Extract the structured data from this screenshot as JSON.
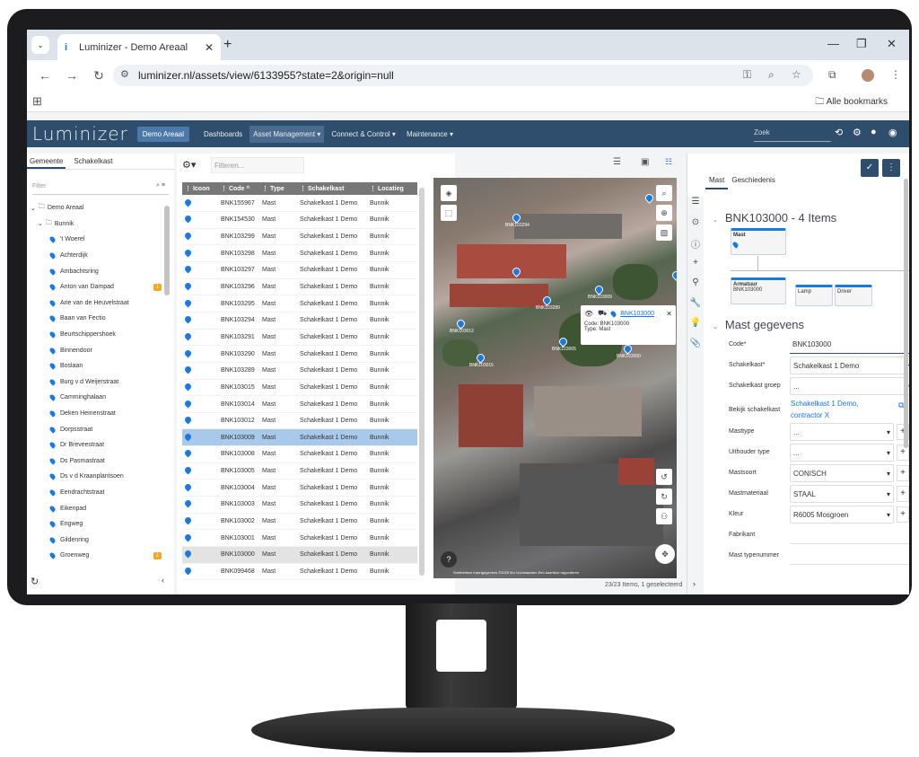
{
  "browser": {
    "tab_title": "Luminizer - Demo Areaal",
    "tab_icon": "i",
    "url": "luminizer.nl/assets/view/6133955?state=2&origin=null",
    "all_bookmarks": "Alle bookmarks"
  },
  "app": {
    "logo": "Luminizer",
    "areaal_button": "Demo Areaal",
    "menu": [
      "Dashboards",
      "Asset Management ▾",
      "Connect & Control ▾",
      "Maintenance ▾"
    ],
    "search_placeholder": "Zoek"
  },
  "left": {
    "tabs": [
      "Gemeente",
      "Schakelkast"
    ],
    "filter_placeholder": "Filter",
    "tree_root": "Demo Areaal",
    "tree_city": "Bunnik",
    "streets": [
      "'t Woerel",
      "Achterdijk",
      "Ambachtsring",
      "Anton van Dampad",
      "Arie van de Heuvelstraat",
      "Baan van Fectio",
      "Beurtschippershoek",
      "Binnendoor",
      "Boslaan",
      "Burg v d Weijerstraat",
      "Camminghalaan",
      "Deken Heinenstraat",
      "Dorpsstraat",
      "Dr Breveestraat",
      "Ds Pasmastraat",
      "Ds v d Kraanplantsoen",
      "Eendrachtstraat",
      "Eikenpad",
      "Engweg",
      "Gildenring",
      "Groenweg"
    ],
    "badges": {
      "Anton van Dampad": "1",
      "Groenweg": "1"
    }
  },
  "table": {
    "filter_placeholder": "Filteren...",
    "headers": [
      "Icoon",
      "Code ^",
      "Type",
      "Schakelkast",
      "Locatieg"
    ],
    "rows": [
      [
        "BNK155967",
        "Mast",
        "Schakelkast 1 Demo",
        "Bunnik"
      ],
      [
        "BNK154530",
        "Mast",
        "Schakelkast 1 Demo",
        "Bunnik"
      ],
      [
        "BNK103299",
        "Mast",
        "Schakelkast 1 Demo",
        "Bunnik"
      ],
      [
        "BNK103298",
        "Mast",
        "Schakelkast 1 Demo",
        "Bunnik"
      ],
      [
        "BNK103297",
        "Mast",
        "Schakelkast 1 Demo",
        "Bunnik"
      ],
      [
        "BNK103296",
        "Mast",
        "Schakelkast 1 Demo",
        "Bunnik"
      ],
      [
        "BNK103295",
        "Mast",
        "Schakelkast 1 Demo",
        "Bunnik"
      ],
      [
        "BNK103294",
        "Mast",
        "Schakelkast 1 Demo",
        "Bunnik"
      ],
      [
        "BNK103291",
        "Mast",
        "Schakelkast 1 Demo",
        "Bunnik"
      ],
      [
        "BNK103290",
        "Mast",
        "Schakelkast 1 Demo",
        "Bunnik"
      ],
      [
        "BNK103289",
        "Mast",
        "Schakelkast 1 Demo",
        "Bunnik"
      ],
      [
        "BNK103015",
        "Mast",
        "Schakelkast 1 Demo",
        "Bunnik"
      ],
      [
        "BNK103014",
        "Mast",
        "Schakelkast 1 Demo",
        "Bunnik"
      ],
      [
        "BNK103012",
        "Mast",
        "Schakelkast 1 Demo",
        "Bunnik"
      ],
      [
        "BNK103009",
        "Mast",
        "Schakelkast 1 Demo",
        "Bunnik"
      ],
      [
        "BNK103008",
        "Mast",
        "Schakelkast 1 Demo",
        "Bunnik"
      ],
      [
        "BNK103005",
        "Mast",
        "Schakelkast 1 Demo",
        "Bunnik"
      ],
      [
        "BNK103004",
        "Mast",
        "Schakelkast 1 Demo",
        "Bunnik"
      ],
      [
        "BNK103003",
        "Mast",
        "Schakelkast 1 Demo",
        "Bunnik"
      ],
      [
        "BNK103002",
        "Mast",
        "Schakelkast 1 Demo",
        "Bunnik"
      ],
      [
        "BNK103001",
        "Mast",
        "Schakelkast 1 Demo",
        "Bunnik"
      ],
      [
        "BNK103000",
        "Mast",
        "Schakelkast 1 Demo",
        "Bunnik"
      ],
      [
        "BNK099468",
        "Mast",
        "Schakelkast 1 Demo",
        "Bunnik"
      ]
    ],
    "selected_code": "BNK103009",
    "hover_code": "BNK103000",
    "footer": "23/23 Items, 1 geselecteerd"
  },
  "map": {
    "popup_link": "BNK103000",
    "popup_code": "Code: BNK103000",
    "popup_type": "Type: Mast",
    "pin_labels": [
      "BNK103294",
      "BNK103289",
      "BNK103000",
      "BNK103012",
      "BNK103015",
      "BNK103005",
      "BNK103009"
    ],
    "attribution": "Sneltoetsen   Kaartgegevens ©2025   5m   Voorwaarden   Een kaartfout rapporteren"
  },
  "detail": {
    "tabs": [
      "Mast",
      "Geschiedenis"
    ],
    "title": "BNK103000 - 4 Items",
    "nodes": {
      "mast": "Mast",
      "armatuur": "Armatuur",
      "armatuur_code": "BNK103000",
      "lamp": "Lamp",
      "driver": "Driver"
    },
    "section": "Mast gegevens",
    "fields": {
      "code_label": "Code*",
      "code_value": "BNK103000",
      "schakelkast_label": "Schakelkast*",
      "schakelkast_value": "Schakelkast 1 Demo",
      "groep_label": "Schakelkast groep",
      "groep_value": "...",
      "bekijk_label": "Bekijk schakelkast",
      "bekijk_value": "Schakelkast 1 Demo, contractor X",
      "masttype_label": "Masttype",
      "masttype_value": "...",
      "uithouder_label": "Uithouder type",
      "uithouder_value": "...",
      "mastsoort_label": "Mastsoort",
      "mastsoort_value": "CONISCH",
      "mastmateriaal_label": "Mastmateriaal",
      "mastmateriaal_value": "STAAL",
      "kleur_label": "Kleur",
      "kleur_value": "R6005 Mosgroen",
      "fabrikant_label": "Fabrikant",
      "fabrikant_value": "",
      "typenummer_label": "Mast typenummer",
      "typenummer_value": ""
    }
  },
  "colors": {
    "navbar": "#2f4d6c",
    "accent": "#1a7ae0",
    "selected_row": "#a9c9ea"
  }
}
